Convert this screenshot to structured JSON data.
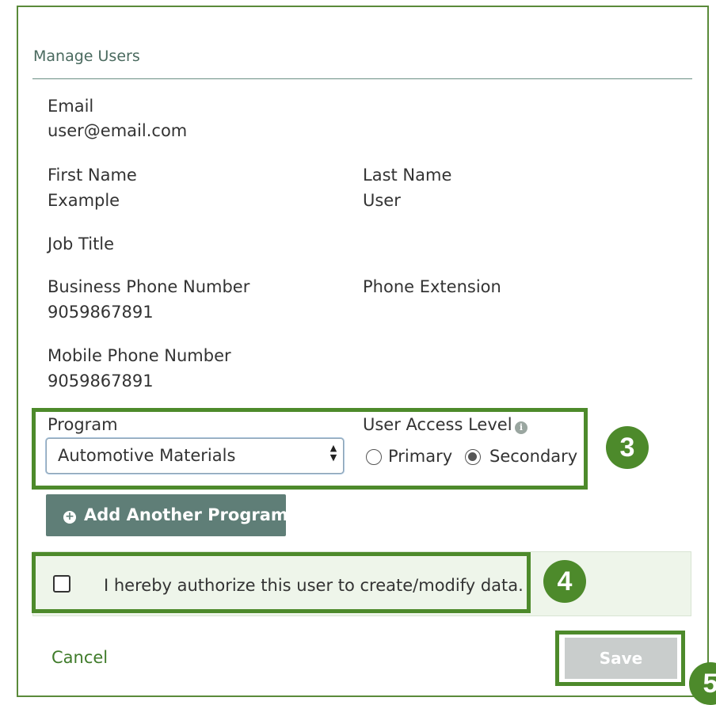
{
  "dialog": {
    "title": "Manage Users"
  },
  "fields": {
    "email_label": "Email",
    "email_value": "user@email.com",
    "first_name_label": "First Name",
    "first_name_value": "Example",
    "last_name_label": "Last Name",
    "last_name_value": "User",
    "job_title_label": "Job Title",
    "business_phone_label": "Business Phone Number",
    "business_phone_value": "9059867891",
    "phone_extension_label": "Phone Extension",
    "mobile_phone_label": "Mobile Phone Number",
    "mobile_phone_value": "9059867891"
  },
  "program": {
    "label": "Program",
    "selected": "Automotive Materials",
    "access_label": "User Access Level",
    "access_options": [
      "Primary",
      "Secondary"
    ],
    "access_selected": "Secondary",
    "add_button_label": "Add Another Program"
  },
  "authorization": {
    "label": "I hereby authorize this user to create/modify data.",
    "checked": false
  },
  "footer": {
    "cancel_label": "Cancel",
    "save_label": "Save"
  },
  "callouts": {
    "step3": "3",
    "step4": "4",
    "step5": "5"
  },
  "colors": {
    "accent_green": "#4d8a2b",
    "button_teal": "#5f7e77",
    "disabled_gray": "#c9cdcc"
  },
  "icons": {
    "info": "info-icon",
    "add": "plus-circle-icon",
    "spinner": "select-updown-icon"
  }
}
